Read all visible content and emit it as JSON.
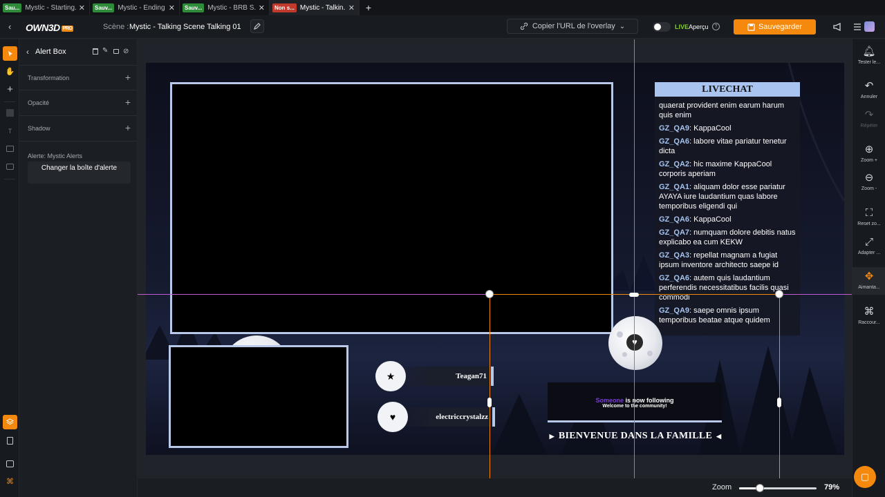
{
  "tabs": [
    {
      "badge": "Sau...",
      "badge_color": "#2e8b3a",
      "title": "Mystic - Starting..."
    },
    {
      "badge": "Sauv...",
      "badge_color": "#2e8b3a",
      "title": "Mystic - Ending ..."
    },
    {
      "badge": "Sauv...",
      "badge_color": "#2e8b3a",
      "title": "Mystic - BRB S..."
    },
    {
      "badge": "Non s...",
      "badge_color": "#c0392b",
      "title": "Mystic - Talkin..."
    }
  ],
  "header": {
    "logo": "OWN3D",
    "logo_pro": "PRO",
    "scene_label": "Scène :",
    "scene_name": "Mystic - Talking Scene Talking 01",
    "copy_url": "Copier l'URL de l'overlay",
    "live": "LIVE",
    "preview": "Aperçu",
    "save": "Sauvegarder"
  },
  "left_panel": {
    "title": "Alert Box",
    "sections": [
      "Transformation",
      "Opacité",
      "Shadow"
    ],
    "alert_label": "Alerte: Mystic Alerts",
    "change_button": "Changer la boîte d'alerte"
  },
  "overlay": {
    "chat_title": "LIVECHAT",
    "messages": [
      {
        "user": "",
        "text": "quaerat provident enim earum harum quis enim"
      },
      {
        "user": "GZ_QA9",
        "text": "KappaCool"
      },
      {
        "user": "GZ_QA6",
        "text": "labore vitae pariatur tenetur dicta"
      },
      {
        "user": "GZ_QA2",
        "text": "hic maxime KappaCool corporis aperiam"
      },
      {
        "user": "GZ_QA1",
        "text": "aliquam dolor esse pariatur AYAYA iure laudantium quas labore temporibus eligendi qui"
      },
      {
        "user": "GZ_QA6",
        "text": "KappaCool"
      },
      {
        "user": "GZ_QA7",
        "text": "numquam dolore debitis natus explicabo ea cum KEKW"
      },
      {
        "user": "GZ_QA3",
        "text": "repellat magnam a fugiat ipsum inventore architecto saepe id"
      },
      {
        "user": "GZ_QA6",
        "text": "autem quis laudantium perferendis necessitatibus facilis quasi commodi"
      },
      {
        "user": "GZ_QA9",
        "text": "saepe omnis ipsum temporibus beatae atque quidem"
      }
    ],
    "followers": [
      {
        "icon": "star-icon",
        "name": "Teagan71"
      },
      {
        "icon": "heart-icon",
        "name": "electriccrystalzz"
      }
    ],
    "alert_name": "Someone",
    "alert_text": "is now following",
    "alert_sub": "Welcome to the community!",
    "banner": "BIENVENUE DANS LA FAMILLE"
  },
  "right_rail": [
    {
      "label": "Tester le...",
      "icon": "bell-icon"
    },
    {
      "label": "Annuler",
      "icon": "undo-icon"
    },
    {
      "label": "Répéter",
      "icon": "redo-icon"
    },
    {
      "label": "Zoom +",
      "icon": "zoom-in-icon"
    },
    {
      "label": "Zoom -",
      "icon": "zoom-out-icon"
    },
    {
      "label": "Reset zo...",
      "icon": "reset-zoom-icon"
    },
    {
      "label": "Adapter ...",
      "icon": "fit-icon"
    },
    {
      "label": "Aimanta...",
      "icon": "magnet-icon"
    },
    {
      "label": "Raccour...",
      "icon": "shortcut-icon"
    }
  ],
  "zoom": {
    "label": "Zoom",
    "value": "79%",
    "level": 0.25
  }
}
